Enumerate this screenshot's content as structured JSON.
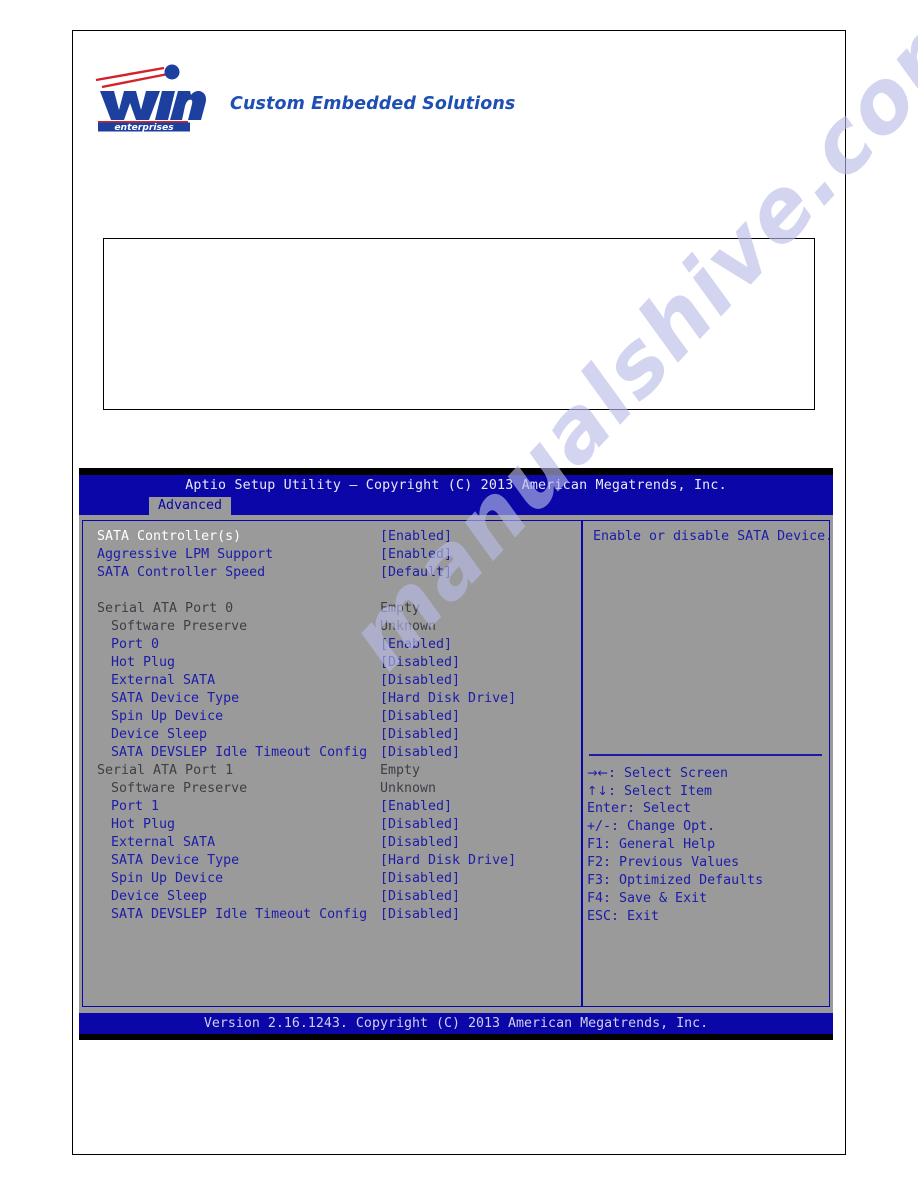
{
  "brand": {
    "logo_word": "win",
    "logo_sub": "enterprises",
    "tagline": "Custom Embedded Solutions"
  },
  "watermark": {
    "text": "manualshive.com"
  },
  "content_box": {
    "text": ""
  },
  "bios": {
    "title": "Aptio Setup Utility – Copyright (C) 2013 American Megatrends, Inc.",
    "active_tab": "Advanced",
    "tabs": [
      "Advanced"
    ],
    "footer": "Version 2.16.1243. Copyright (C) 2013 American Megatrends, Inc.",
    "help": {
      "text": "Enable or disable SATA Device."
    },
    "items": [
      {
        "label": "SATA Controller(s)",
        "value": "[Enabled]",
        "style": "selected",
        "indent": false
      },
      {
        "label": "Aggressive LPM Support",
        "value": "[Enabled]",
        "style": "option",
        "indent": false
      },
      {
        "label": "SATA Controller Speed",
        "value": "[Default]",
        "style": "option",
        "indent": false
      },
      {
        "label": "",
        "value": "",
        "style": "spacer",
        "indent": false
      },
      {
        "label": "Serial ATA Port 0",
        "value": "Empty",
        "style": "info",
        "indent": false
      },
      {
        "label": "Software Preserve",
        "value": "Unknown",
        "style": "info",
        "indent": true
      },
      {
        "label": "Port 0",
        "value": "[Enabled]",
        "style": "option",
        "indent": true
      },
      {
        "label": "Hot Plug",
        "value": "[Disabled]",
        "style": "option",
        "indent": true
      },
      {
        "label": "External SATA",
        "value": "[Disabled]",
        "style": "option",
        "indent": true
      },
      {
        "label": "SATA Device Type",
        "value": "[Hard Disk Drive]",
        "style": "option",
        "indent": true
      },
      {
        "label": "Spin Up Device",
        "value": "[Disabled]",
        "style": "option",
        "indent": true
      },
      {
        "label": "Device Sleep",
        "value": "[Disabled]",
        "style": "option",
        "indent": true
      },
      {
        "label": "SATA DEVSLEP Idle Timeout Config",
        "value": "[Disabled]",
        "style": "option",
        "indent": true
      },
      {
        "label": "Serial ATA Port 1",
        "value": "Empty",
        "style": "info",
        "indent": false
      },
      {
        "label": "Software Preserve",
        "value": "Unknown",
        "style": "info",
        "indent": true
      },
      {
        "label": "Port 1",
        "value": "[Enabled]",
        "style": "option",
        "indent": true
      },
      {
        "label": "Hot Plug",
        "value": "[Disabled]",
        "style": "option",
        "indent": true
      },
      {
        "label": "External SATA",
        "value": "[Disabled]",
        "style": "option",
        "indent": true
      },
      {
        "label": "SATA Device Type",
        "value": "[Hard Disk Drive]",
        "style": "option",
        "indent": true
      },
      {
        "label": "Spin Up Device",
        "value": "[Disabled]",
        "style": "option",
        "indent": true
      },
      {
        "label": "Device Sleep",
        "value": "[Disabled]",
        "style": "option",
        "indent": true
      },
      {
        "label": "SATA DEVSLEP Idle Timeout Config",
        "value": "[Disabled]",
        "style": "option",
        "indent": true
      }
    ],
    "keys": [
      {
        "glyph": "→←",
        "text": ": Select Screen"
      },
      {
        "glyph": "↑↓",
        "text": ": Select Item"
      },
      {
        "glyph": "",
        "text": "Enter: Select"
      },
      {
        "glyph": "",
        "text": "+/-: Change Opt."
      },
      {
        "glyph": "",
        "text": "F1: General Help"
      },
      {
        "glyph": "",
        "text": "F2: Previous Values"
      },
      {
        "glyph": "",
        "text": "F3: Optimized Defaults"
      },
      {
        "glyph": "",
        "text": "F4: Save & Exit"
      },
      {
        "glyph": "",
        "text": "ESC: Exit"
      }
    ]
  },
  "colors": {
    "bios_blue": "#0a06a8",
    "bios_gray": "#9a9a9a",
    "option_blue": "#1c1ca8",
    "selected_white": "#ffffff",
    "info_gray": "#3e3e46",
    "brand_blue": "#1e4fb4",
    "brand_red": "#d2232a",
    "watermark": "#b9bce8"
  }
}
